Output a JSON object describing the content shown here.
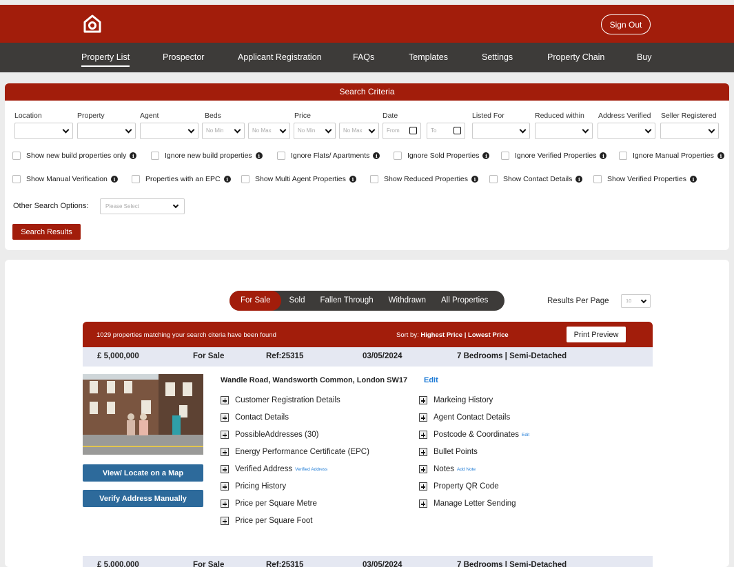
{
  "header": {
    "logo_icon": "home-logo-icon",
    "sign_out_label": "Sign Out"
  },
  "nav": {
    "items": [
      "Property List",
      "Prospector",
      "Applicant Registration",
      "FAQs",
      "Templates",
      "Settings",
      "Property Chain",
      "Buy"
    ],
    "active": "Property List"
  },
  "search": {
    "title": "Search Criteria",
    "labels": {
      "location": "Location",
      "property": "Property",
      "agent": "Agent",
      "beds": "Beds",
      "price": "Price",
      "date": "Date",
      "listed_for": "Listed For",
      "reduced_within": "Reduced within",
      "address_verified": "Address Verified",
      "seller_registered": "Seller Registered"
    },
    "placeholders": {
      "beds_min": "No Min",
      "beds_max": "No Max",
      "price_min": "No Min",
      "price_max": "No Max",
      "date_from": "From",
      "date_to": "To"
    },
    "checkboxes_row1": [
      "Show new build properties only",
      "Ignore new build properties",
      "Ignore Flats/ Apartments",
      "Ignore Sold Properties",
      "Ignore Verified Properties",
      "Ignore Manual Properties"
    ],
    "checkboxes_row2": [
      "Show Manual Verification",
      "Properties with an EPC",
      "Show Multi Agent Properties",
      "Show Reduced Properties",
      "Show Contact Details",
      "Show Verified Properties"
    ],
    "other_label": "Other Search Options:",
    "other_placeholder": "Please Select",
    "search_button": "Search Results"
  },
  "results": {
    "tabs": [
      "For Sale",
      "Sold",
      "Fallen Through",
      "Withdrawn",
      "All Properties"
    ],
    "active_tab": "For Sale",
    "results_per_page_label": "Results Per Page",
    "results_per_page_value": "10",
    "match_text": "1029 properties matching your search citeria have been found",
    "sort_label": "Sort by: ",
    "sort_options": "Highest Price | Lowest Price",
    "print_preview": "Print Preview",
    "properties": [
      {
        "price": "£ 5,000,000",
        "status": "For Sale",
        "ref": "Ref:25315",
        "date": "03/05/2024",
        "summary": "7 Bedrooms | Semi-Detached",
        "address": "Wandle Road, Wandsworth Common, London SW17",
        "edit": "Edit",
        "map_button": "View/ Locate on a Map",
        "verify_button": "Verify Address Manually",
        "left_items": [
          "Customer Registration Details",
          "Contact Details",
          "PossibleAddresses (30)",
          "Energy Performance Certificate (EPC)",
          "Verified Address",
          "Pricing History",
          "Price per Square Metre",
          "Price per Square Foot"
        ],
        "verified_address_link": "Verified Address",
        "right_items": [
          "Markeing History",
          "Agent Contact Details",
          "Postcode & Coordinates",
          "Bullet Points",
          "Notes",
          "Property QR Code",
          "Manage Letter Sending"
        ],
        "postcode_link": "Edit",
        "notes_link": "Add Note"
      },
      {
        "price": "£ 5,000,000",
        "status": "For Sale",
        "ref": "Ref:25315",
        "date": "03/05/2024",
        "summary": "7 Bedrooms | Semi-Detached"
      }
    ]
  },
  "colors": {
    "brand_red": "#a21d0b",
    "nav_dark": "#3d3b39",
    "button_blue": "#2d6a9b",
    "link_blue": "#1e7bd6",
    "row_gray": "#e5e8f2"
  }
}
